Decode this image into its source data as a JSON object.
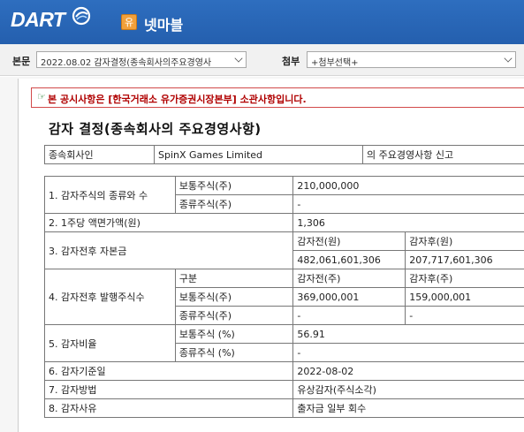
{
  "header": {
    "logo_text": "DART",
    "corp_badge": "유",
    "corp_name": "넷마블",
    "colors": {
      "header_bg": "#2766b7",
      "badge": "#f2a03a",
      "notice_border": "#d24a4a",
      "notice_text": "#b00000"
    }
  },
  "toolbar": {
    "main_label": "본문",
    "main_select": "2022.08.02  감자결정(종속회사의주요경영사",
    "attach_label": "첨부",
    "attach_select": "+첨부선택+"
  },
  "notice": {
    "icon": "pointing-hand-icon",
    "text": "본 공시사항은 [한국거래소 유가증권시장본부] 소관사항입니다."
  },
  "title": "감자 결정(종속회사의 주요경영사항)",
  "subsidiary": {
    "label": "종속회사인",
    "name": "SpinX Games Limited",
    "suffix": "의 주요경영사항 신고"
  },
  "rows": {
    "r1_label": "1. 감자주식의 종류와 수",
    "r1_common": "보통주식(주)",
    "r1_common_val": "210,000,000",
    "r1_pref": "종류주식(주)",
    "r1_pref_val": "-",
    "r2_label": "2. 1주당 액면가액(원)",
    "r2_val": "1,306",
    "r3_label": "3. 감자전후 자본금",
    "r3_before_h": "감자전(원)",
    "r3_after_h": "감자후(원)",
    "r3_before": "482,061,601,306",
    "r3_after": "207,717,601,306",
    "r4_label": "4. 감자전후 발행주식수",
    "r4_kind_h": "구분",
    "r4_before_h": "감자전(주)",
    "r4_after_h": "감자후(주)",
    "r4_common": "보통주식(주)",
    "r4_common_before": "369,000,001",
    "r4_common_after": "159,000,001",
    "r4_pref": "종류주식(주)",
    "r4_pref_before": "-",
    "r4_pref_after": "-",
    "r5_label": "5. 감자비율",
    "r5_common": "보통주식 (%)",
    "r5_common_val": "56.91",
    "r5_pref": "종류주식 (%)",
    "r5_pref_val": "-",
    "r6_label": "6. 감자기준일",
    "r6_val": "2022-08-02",
    "r7_label": "7. 감자방법",
    "r7_val": "유상감자(주식소각)",
    "r8_label": "8. 감자사유",
    "r8_val": "출자금 일부 회수"
  }
}
